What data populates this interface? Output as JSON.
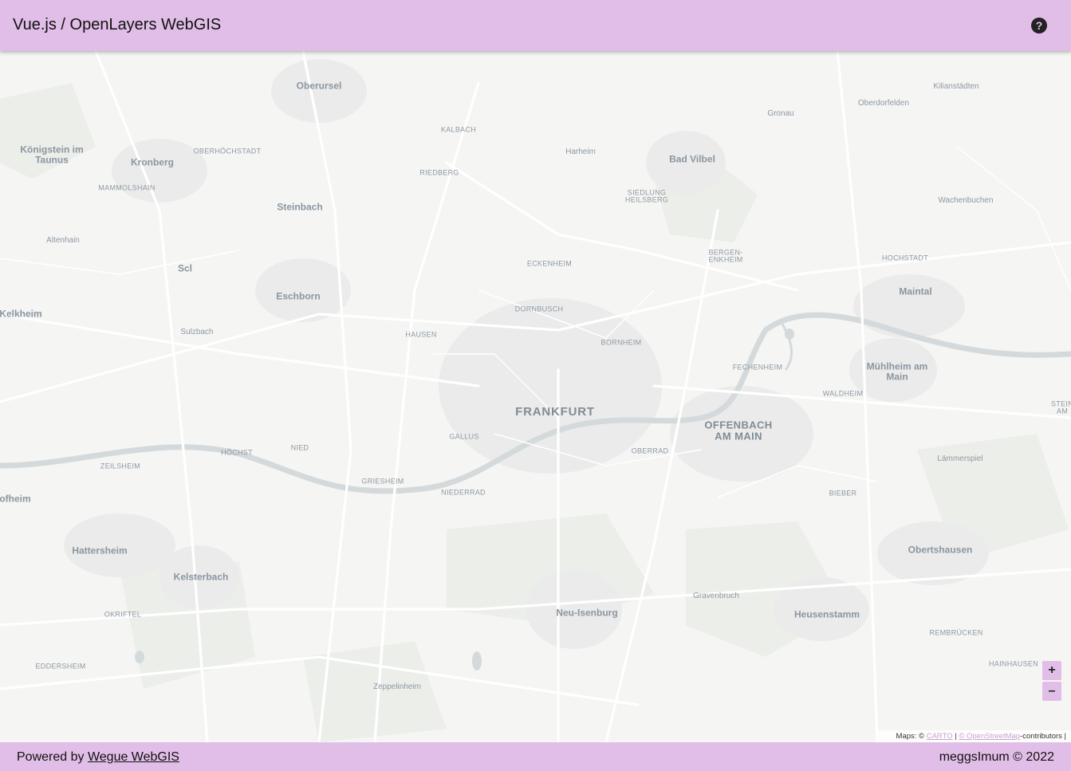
{
  "header": {
    "title": "Vue.js / OpenLayers WebGIS",
    "help_icon": "help-circle-icon",
    "help_symbol": "?"
  },
  "map": {
    "labels": [
      {
        "text": "Oberursel",
        "cls": "town",
        "key": "oberursel"
      },
      {
        "text": "Kilianstädten",
        "cls": "small",
        "key": "kilianstaedten"
      },
      {
        "text": "Oberdorfelden",
        "cls": "small",
        "key": "oberdorfelden"
      },
      {
        "text": "Gronau",
        "cls": "small",
        "key": "gronau"
      },
      {
        "text": "KALBACH",
        "cls": "dist",
        "key": "kalbach"
      },
      {
        "text": "Harheim",
        "cls": "small",
        "key": "harheim"
      },
      {
        "text": "Königstein im\nTaunus",
        "cls": "town",
        "key": "koenigstein"
      },
      {
        "text": "Kronberg",
        "cls": "town",
        "key": "kronberg"
      },
      {
        "text": "OBERHÖCHSTADT",
        "cls": "dist",
        "key": "oberhoechstadt"
      },
      {
        "text": "Bad Vilbel",
        "cls": "town",
        "key": "bad-vilbel"
      },
      {
        "text": "RIEDBERG",
        "cls": "dist",
        "key": "riedberg"
      },
      {
        "text": "MAMMOLSHAIN",
        "cls": "dist",
        "key": "mammolshain"
      },
      {
        "text": "SIEDLUNG\nHEILSBERG",
        "cls": "dist",
        "key": "heilsberg"
      },
      {
        "text": "Wachenbuchen",
        "cls": "small",
        "key": "wachenbuchen"
      },
      {
        "text": "Steinbach",
        "cls": "town",
        "key": "steinbach"
      },
      {
        "text": "Altenhain",
        "cls": "small",
        "key": "altenhain"
      },
      {
        "text": "BERGEN-\nENKHEIM",
        "cls": "dist",
        "key": "bergen-enkheim"
      },
      {
        "text": "HOCHSTADT",
        "cls": "dist",
        "key": "hochstadt"
      },
      {
        "text": "ECKENHEIM",
        "cls": "dist",
        "key": "eckenheim"
      },
      {
        "text": "Scl",
        "cls": "town",
        "key": "scl"
      },
      {
        "text": "Maintal",
        "cls": "town",
        "key": "maintal"
      },
      {
        "text": "Eschborn",
        "cls": "town",
        "key": "eschborn"
      },
      {
        "text": "DORNBUSCH",
        "cls": "dist",
        "key": "dornbusch"
      },
      {
        "text": "Kelkheim",
        "cls": "town",
        "key": "kelkheim"
      },
      {
        "text": "Sulzbach",
        "cls": "small",
        "key": "sulzbach"
      },
      {
        "text": "HAUSEN",
        "cls": "dist",
        "key": "hausen"
      },
      {
        "text": "BORNHEIM",
        "cls": "dist",
        "key": "bornheim"
      },
      {
        "text": "FECHENHEIM",
        "cls": "dist",
        "key": "fechenheim"
      },
      {
        "text": "Mühlheim am\nMain",
        "cls": "town",
        "key": "muehlheim"
      },
      {
        "text": "WALDHEIM",
        "cls": "dist",
        "key": "waldheim"
      },
      {
        "text": "FRANKFURT",
        "cls": "major",
        "key": "frankfurt"
      },
      {
        "text": "STEIN\nAM",
        "cls": "dist",
        "key": "steinheim"
      },
      {
        "text": "OFFENBACH\nAM MAIN",
        "cls": "city2",
        "key": "offenbach"
      },
      {
        "text": "GALLUS",
        "cls": "dist",
        "key": "gallus"
      },
      {
        "text": "NIED",
        "cls": "dist",
        "key": "nied"
      },
      {
        "text": "HÖCHST",
        "cls": "dist",
        "key": "hoechst"
      },
      {
        "text": "OBERRAD",
        "cls": "dist",
        "key": "oberrad"
      },
      {
        "text": "Lämmerspiel",
        "cls": "small",
        "key": "laemmerspiel"
      },
      {
        "text": "ZEILSHEIM",
        "cls": "dist",
        "key": "zeilsheim"
      },
      {
        "text": "GRIESHEIM",
        "cls": "dist",
        "key": "griesheim"
      },
      {
        "text": "NIEDERRAD",
        "cls": "dist",
        "key": "niederrad"
      },
      {
        "text": "BIEBER",
        "cls": "dist",
        "key": "bieber"
      },
      {
        "text": "ofheim",
        "cls": "town",
        "key": "hofheim"
      },
      {
        "text": "Hattersheim",
        "cls": "town",
        "key": "hattersheim"
      },
      {
        "text": "Obertshausen",
        "cls": "town",
        "key": "obertshausen"
      },
      {
        "text": "Kelsterbach",
        "cls": "town",
        "key": "kelsterbach"
      },
      {
        "text": "Gravenbruch",
        "cls": "small",
        "key": "gravenbruch"
      },
      {
        "text": "Neu-Isenburg",
        "cls": "town",
        "key": "neu-isenburg"
      },
      {
        "text": "Heusenstamm",
        "cls": "town",
        "key": "heusenstamm"
      },
      {
        "text": "OKRIFTEL",
        "cls": "dist",
        "key": "okriftel"
      },
      {
        "text": "REMBRÜCKEN",
        "cls": "dist",
        "key": "rembruecken"
      },
      {
        "text": "EDDERSHEIM",
        "cls": "dist",
        "key": "eddersheim"
      },
      {
        "text": "HAINHAUSEN",
        "cls": "dist",
        "key": "hainhausen"
      },
      {
        "text": "Zeppelinheim",
        "cls": "small",
        "key": "zeppelinheim"
      }
    ],
    "zoom_in": "+",
    "zoom_out": "–",
    "attribution": {
      "prefix": "Maps: ©",
      "carto": "CARTO",
      "sep": "|",
      "osm": "© OpenStreetMap",
      "suffix": "-contributors |"
    }
  },
  "footer": {
    "powered_prefix": "Powered by",
    "powered_link": "Wegue WebGIS",
    "copyright": "meggsImum © 2022"
  },
  "colors": {
    "accent": "#e1bee7",
    "map_bg": "#f5f5f3",
    "water": "#d4dadc",
    "road": "#ffffff"
  }
}
